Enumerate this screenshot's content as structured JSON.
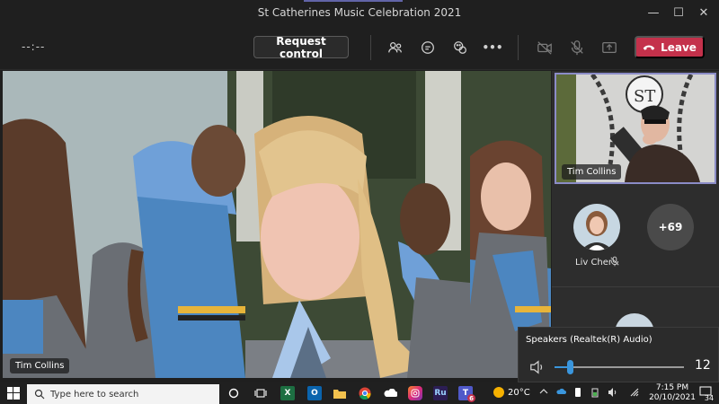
{
  "window": {
    "title": "St Catherines Music Celebration 2021",
    "minimize_glyph": "—",
    "maximize_glyph": "☐",
    "close_glyph": "✕"
  },
  "toolbar": {
    "timer": "--:--",
    "request_control_label": "Request control",
    "leave_label": "Leave",
    "more_glyph": "•••",
    "icons": [
      "people-icon",
      "chat-icon",
      "reactions-icon",
      "more-options-icon",
      "camera-off-icon",
      "mic-off-icon",
      "share-icon",
      "phone-icon"
    ]
  },
  "main_video": {
    "participant_name": "Tim Collins"
  },
  "right_panel": {
    "pip_name": "Tim Collins",
    "participant_name": "Liv Cher",
    "more_participants": "+69"
  },
  "speaker_popup": {
    "device_label": "Speakers (Realtek(R) Audio)",
    "volume": 12,
    "volume_value": "12"
  },
  "taskbar": {
    "search_placeholder": "Type here to search",
    "weather": "20°C",
    "time": "7:15 PM",
    "date": "20/10/2021",
    "notification_count": "34",
    "app_labels": {
      "excel": "X",
      "outlook": "O",
      "premiere_rush": "Ru",
      "teams": "T"
    },
    "teams_badge": "6"
  },
  "colors": {
    "accent": "#6264a7",
    "leave_red": "#c4314b",
    "slider_blue": "#3a96dd",
    "background": "#1f1f1f"
  }
}
